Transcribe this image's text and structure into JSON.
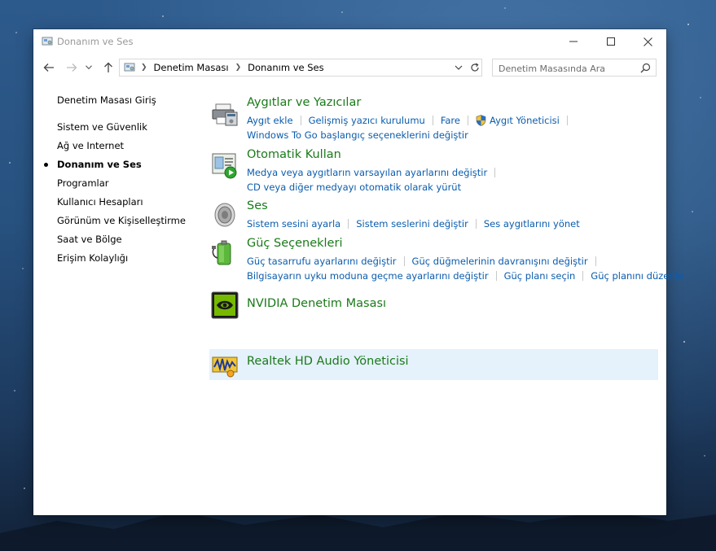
{
  "window": {
    "title": "Donanım ve Ses"
  },
  "address": {
    "segments": [
      "Denetim Masası",
      "Donanım ve Ses"
    ]
  },
  "search": {
    "placeholder": "Denetim Masasında Ara"
  },
  "sidebar": {
    "items": [
      {
        "label": "Denetim Masası Giriş",
        "active": false
      },
      {
        "label": "Sistem ve Güvenlik",
        "active": false
      },
      {
        "label": "Ağ ve Internet",
        "active": false
      },
      {
        "label": "Donanım ve Ses",
        "active": true
      },
      {
        "label": "Programlar",
        "active": false
      },
      {
        "label": "Kullanıcı Hesapları",
        "active": false
      },
      {
        "label": "Görünüm ve Kişiselleştirme",
        "active": false
      },
      {
        "label": "Saat ve Bölge",
        "active": false
      },
      {
        "label": "Erişim Kolaylığı",
        "active": false
      }
    ]
  },
  "categories": [
    {
      "title": "Aygıtlar ve Yazıcılar",
      "icon": "printer-icon",
      "links": [
        "Aygıt ekle",
        "Gelişmiş yazıcı kurulumu",
        "Fare",
        "Aygıt Yöneticisi",
        "Windows To Go başlangıç seçeneklerini değiştir"
      ]
    },
    {
      "title": "Otomatik Kullan",
      "icon": "autoplay-icon",
      "links": [
        "Medya veya aygıtların varsayılan ayarlarını değiştir",
        "CD veya diğer medyayı otomatik olarak yürüt"
      ]
    },
    {
      "title": "Ses",
      "icon": "speaker-icon",
      "links": [
        "Sistem sesini ayarla",
        "Sistem seslerini değiştir",
        "Ses aygıtlarını yönet"
      ]
    },
    {
      "title": "Güç Seçenekleri",
      "icon": "battery-icon",
      "links": [
        "Güç tasarrufu ayarlarını değiştir",
        "Güç düğmelerinin davranışını değiştir",
        "Bilgisayarın uyku moduna geçme ayarlarını değiştir",
        "Güç planı seçin",
        "Güç planını düzenle"
      ]
    },
    {
      "title": "NVIDIA Denetim Masası",
      "icon": "nvidia-icon",
      "links": []
    },
    {
      "title": "Realtek HD Audio Yöneticisi",
      "icon": "realtek-audio-icon",
      "links": []
    }
  ],
  "colors": {
    "category_title": "#1a7a1a",
    "link": "#0b5cad",
    "hover_row": "#e5f1fb"
  }
}
